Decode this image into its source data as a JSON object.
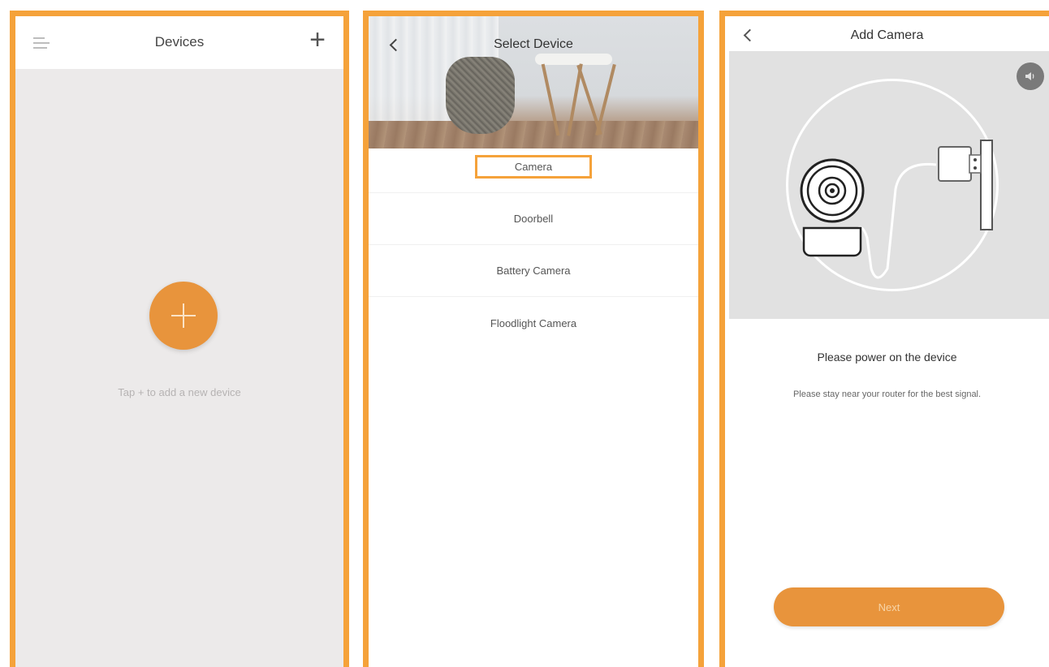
{
  "devices_screen": {
    "title": "Devices",
    "add_symbol": "+",
    "empty_hint": "Tap + to add a new device"
  },
  "select_screen": {
    "title": "Select Device",
    "items": [
      {
        "label": "Camera",
        "selected": true
      },
      {
        "label": "Doorbell",
        "selected": false
      },
      {
        "label": "Battery Camera",
        "selected": false
      },
      {
        "label": "Floodlight Camera",
        "selected": false
      }
    ]
  },
  "add_camera_screen": {
    "title": "Add Camera",
    "instruction_title": "Please power on the device",
    "instruction_sub": "Please stay near your router for the best signal.",
    "next_label": "Next"
  },
  "colors": {
    "accent": "#f5a23a",
    "button": "#e8943c",
    "panel_bg": "#eceaea"
  },
  "icons": [
    "menu-icon",
    "plus-icon",
    "back-arrow-icon",
    "speaker-icon",
    "camera-icon",
    "power-adapter-icon"
  ]
}
